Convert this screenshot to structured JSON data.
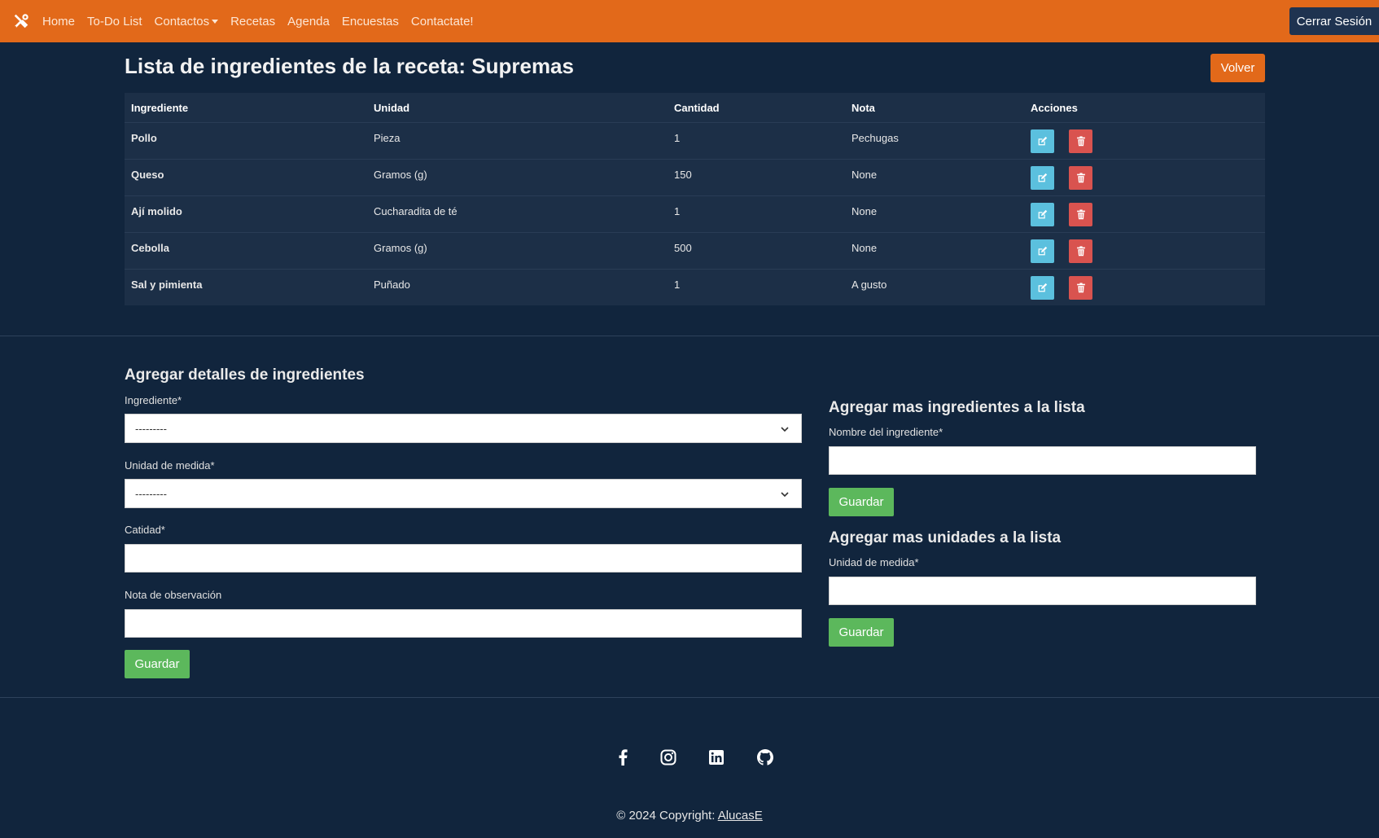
{
  "navbar": {
    "items": [
      "Home",
      "To-Do List",
      "Contactos",
      "Recetas",
      "Agenda",
      "Encuestas",
      "Contactate!"
    ],
    "logout_label": "Cerrar Sesión"
  },
  "page": {
    "title": "Lista de ingredientes de la receta: Supremas",
    "back_label": "Volver"
  },
  "table": {
    "headers": [
      "Ingrediente",
      "Unidad",
      "Cantidad",
      "Nota",
      "Acciones"
    ],
    "rows": [
      [
        "Pollo",
        "Pieza",
        "1",
        "Pechugas"
      ],
      [
        "Queso",
        "Gramos (g)",
        "150",
        "None"
      ],
      [
        "Ají molido",
        "Cucharadita de té",
        "1",
        "None"
      ],
      [
        "Cebolla",
        "Gramos (g)",
        "500",
        "None"
      ],
      [
        "Sal y pimienta",
        "Puñado",
        "1",
        "A gusto"
      ]
    ]
  },
  "details_form": {
    "title": "Agregar detalles de ingredientes",
    "ingredient_label": "Ingrediente*",
    "ingredient_value": "---------",
    "unit_label": "Unidad de medida*",
    "unit_value": "---------",
    "quantity_label": "Catidad*",
    "note_label": "Nota de observación",
    "save_label": "Guardar"
  },
  "add_ingredient": {
    "title": "Agregar mas ingredientes a la lista",
    "name_label": "Nombre del ingrediente*",
    "save_label": "Guardar"
  },
  "add_unit": {
    "title": "Agregar mas unidades a la lista",
    "unit_label": "Unidad de medida*",
    "save_label": "Guardar"
  },
  "footer": {
    "copyright_prefix": "© 2024 Copyright: ",
    "copyright_link": "AlucasE"
  },
  "colors": {
    "navbar": "#e2691a",
    "background": "#11253d",
    "table": "#1c2f47",
    "edit": "#5bc0de",
    "delete": "#d9534f",
    "save": "#5cb85c"
  }
}
